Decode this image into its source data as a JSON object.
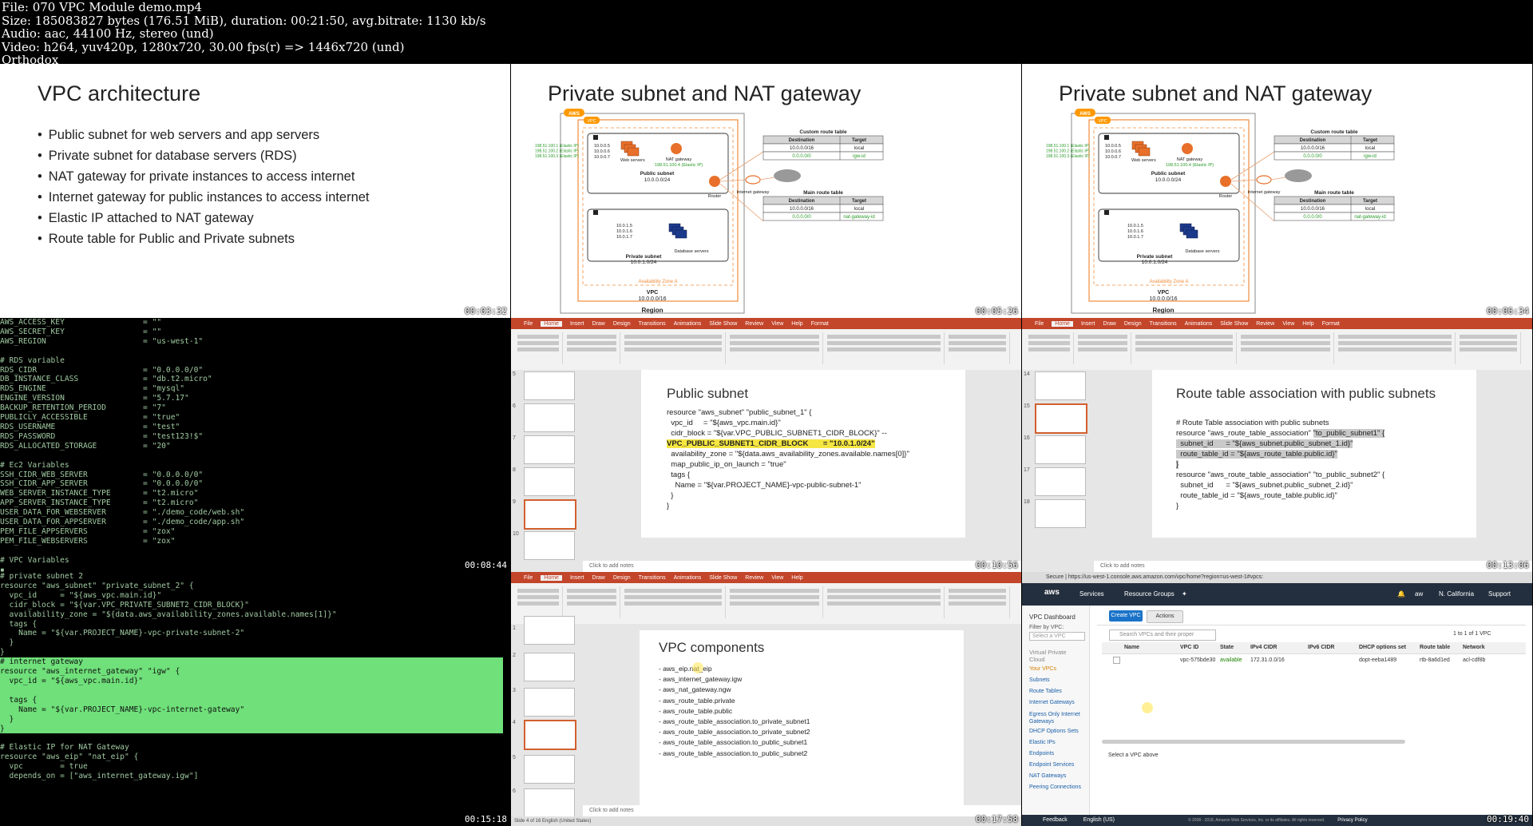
{
  "header": {
    "line1": "File: 070 VPC Module demo.mp4",
    "line2": "Size: 185083827 bytes (176.51 MiB), duration: 00:21:50, avg.bitrate: 1130 kb/s",
    "line3": "Audio: aac, 44100 Hz, stereo (und)",
    "line4": "Video: h264, yuv420p, 1280x720, 30.00 fps(r) => 1446x720 (und)",
    "line5": "Orthodox"
  },
  "tiles": {
    "t1": {
      "timestamp": "00:03:32",
      "title": "VPC architecture",
      "bullets": [
        "Public subnet for web servers and app servers",
        "Private subnet for database servers (RDS)",
        "NAT gateway for private instances to access internet",
        "Internet gateway for public instances to access internet",
        "Elastic IP attached to NAT gateway",
        "Route table for Public and Private subnets"
      ]
    },
    "t2": {
      "timestamp": "00:05:26",
      "title": "Private subnet and NAT gateway"
    },
    "t3": {
      "timestamp": "00:06:34",
      "title": "Private subnet and NAT gateway"
    },
    "diagram": {
      "custom_route_table": "Custom route table",
      "main_route_table": "Main route table",
      "destination": "Destination",
      "target": "Target",
      "cr_rows": [
        [
          "10.0.0.0/16",
          "local"
        ],
        [
          "0.0.0.0/0",
          "igw-id"
        ]
      ],
      "mr_rows": [
        [
          "10.0.0.0/16",
          "local"
        ],
        [
          "0.0.0.0/0",
          "nat-gateway-id"
        ]
      ],
      "public_subnet": "Public subnet",
      "public_cidr": "10.0.0.0/24",
      "private_subnet": "Private subnet",
      "private_cidr": "10.0.1.0/24",
      "vpc": "VPC",
      "vpc_cidr": "10.0.0.0/16",
      "region": "Region",
      "az": "Availability Zone A",
      "web_servers": "Web servers",
      "nat_gateway": "NAT gateway",
      "nat_ip": "198.51.100.4 (Elastic IP)",
      "internet_gateway": "Internet gateway",
      "router": "Router",
      "db_servers": "Database servers",
      "pub_ips": "10.0.0.5\n10.0.0.6\n10.0.0.7",
      "priv_ips": "10.0.1.5\n10.0.1.6\n10.0.1.7",
      "eips": "198.51.100.1 (Elastic IP)\n198.51.100.2 (Elastic IP)\n198.51.100.3 (Elastic IP)",
      "aws": "AWS",
      "vpc_badge": "VPC"
    },
    "t4": {
      "timestamp": "00:08:44",
      "code_a": "AWS_ACCESS_KEY                 = \"\"\nAWS_SECRET_KEY                 = \"\"\nAWS_REGION                     = \"us-west-1\"\n\n# RDS variable\nRDS_CIDR                       = \"0.0.0.0/0\"\nDB_INSTANCE_CLASS              = \"db.t2.micro\"\nRDS_ENGINE                     = \"mysql\"\nENGINE_VERSION                 = \"5.7.17\"\nBACKUP_RETENTION_PERIOD        = \"7\"\nPUBLICLY_ACCESSIBLE            = \"true\"\nRDS_USERNAME                   = \"test\"\nRDS_PASSWORD                   = \"test123!$\"\nRDS_ALLOCATED_STORAGE          = \"20\"\n\n# Ec2 Variables\nSSH_CIDR_WEB_SERVER            = \"0.0.0.0/0\"\nSSH_CIDR_APP_SERVER            = \"0.0.0.0/0\"\nWEB_SERVER_INSTANCE_TYPE       = \"t2.micro\"\nAPP_SERVER_INSTANCE_TYPE       = \"t2.micro\"\nUSER_DATA_FOR_WEBSERVER        = \"./demo_code/web.sh\"\nUSER_DATA_FOR_APPSERVER        = \"./demo_code/app.sh\"\nPEM_FILE_APPSERVERS            = \"zox\"\nPEM_FILE_WEBSERVERS            = \"zox\"\n\n# VPC Variables\n▪"
    },
    "t5": {
      "timestamp": "00:10:56",
      "slide_title": "Public subnet",
      "line1": "resource \"aws_subnet\" \"public_subnet_1\" {",
      "line2": "  vpc_id     = \"${aws_vpc.main.id}\"",
      "line3": "  cidr_block = \"${var.VPC_PUBLIC_SUBNET1_CIDR_BLOCK}\" --",
      "line4a": "VPC_PUBLIC_SUBNET1_CIDR_BLOCK       = ",
      "line4b": "\"10.0.1.0/24\"",
      "line5": "  availability_zone = \"${data.aws_availability_zones.available.names[0]}\"",
      "line6": "  map_public_ip_on_launch = \"true\"",
      "line7": "  tags {",
      "line8": "    Name = \"${var.PROJECT_NAME}-vpc-public-subnet-1\"",
      "line9": "  }",
      "line10": "}",
      "notes": "Click to add notes"
    },
    "t6": {
      "timestamp": "00:13:06",
      "slide_title": "Route table association with public subnets",
      "l1": "# Route Table association with public subnets",
      "l2a": "resource \"aws_route_table_association\" ",
      "l2b": "\"to_public_subnet1\" {",
      "l3": "  subnet_id      = \"${aws_subnet.public_subnet_1.id}\"",
      "l4": "  route_table_id = \"${aws_route_table.public.id}\"",
      "l5": "}",
      "l6": "resource \"aws_route_table_association\" \"to_public_subnet2\" {",
      "l7": "  subnet_id      = \"${aws_subnet.public_subnet_2.id}\"",
      "l8": "  route_table_id = \"${aws_route_table.public.id}\"",
      "l9": "}",
      "notes": "Click to add notes"
    },
    "t7": {
      "timestamp": "00:15:18",
      "code_a": "# private subnet 2\nresource \"aws_subnet\" \"private_subnet_2\" {\n  vpc_id     = \"${aws_vpc.main.id}\"\n  cidr_block = \"${var.VPC_PRIVATE_SUBNET2_CIDR_BLOCK}\"\n  availability_zone = \"${data.aws_availability_zones.available.names[1]}\"\n  tags {\n    Name = \"${var.PROJECT_NAME}-vpc-private-subnet-2\"\n  }\n}\n",
      "code_hl": "# internet gateway\nresource \"aws_internet_gateway\" \"igw\" {\n  vpc_id = \"${aws_vpc.main.id}\"\n\n  tags {\n    Name = \"${var.PROJECT_NAME}-vpc-internet-gateway\"\n  }\n}",
      "code_b": "\n# Elastic IP for NAT Gateway\nresource \"aws_eip\" \"nat_eip\" {\n  vpc        = true\n  depends_on = [\"aws_internet_gateway.igw\"]"
    },
    "t8": {
      "timestamp": "00:17:58",
      "slide_title": "VPC components",
      "items": [
        "- aws_eip.nat_eip",
        "- aws_internet_gateway.igw",
        "- aws_nat_gateway.ngw",
        "- aws_route_table.private",
        "- aws_route_table.public",
        "- aws_route_table_association.to_private_subnet1",
        "- aws_route_table_association.to_private_subnet2",
        "- aws_route_table_association.to_public_subnet1",
        "- aws_route_table_association.to_public_subnet2"
      ],
      "notes": "Click to add notes",
      "status": "Slide 4 of 16    English (United States)"
    },
    "t9": {
      "timestamp": "00:19:40",
      "url": "Secure | https://us-west-1.console.aws.amazon.com/vpc/home?region=us-west-1#vpcs:",
      "services": "Services",
      "resource_groups": "Resource Groups",
      "user": "aw",
      "region": "N. California",
      "support": "Support",
      "dashboard": "VPC Dashboard",
      "filter_by": "Filter by VPC:",
      "select_vpc": "Select a VPC",
      "nav": [
        "Virtual Private Cloud",
        "Your VPCs",
        "Subnets",
        "Route Tables",
        "Internet Gateways",
        "Egress Only Internet Gateways",
        "DHCP Options Sets",
        "Elastic IPs",
        "Endpoints",
        "Endpoint Services",
        "NAT Gateways",
        "Peering Connections"
      ],
      "create_vpc": "Create VPC",
      "actions": "Actions",
      "search_placeholder": "Search VPCs and their proper",
      "count": "1 to 1 of 1 VPC",
      "cols": [
        "Name",
        "VPC ID",
        "State",
        "IPv4 CIDR",
        "IPv6 CIDR",
        "DHCP options set",
        "Route table",
        "Network"
      ],
      "row": [
        "",
        "vpc-575bde30",
        "available",
        "172.31.0.0/16",
        "",
        "dopt-eeba1489",
        "rtb-8a6d1ed",
        "acl-cdf8b"
      ],
      "select_above": "Select a VPC above",
      "feedback": "Feedback",
      "lang": "English (US)",
      "copyright": "© 2008 - 2018, Amazon Web Services, Inc. or its affiliates. All rights reserved.",
      "privacy": "Privacy Policy"
    }
  },
  "colors": {
    "aws_orange": "#ff9900",
    "ppt_red": "#c3452a",
    "term_green": "#6fe07a",
    "aws_navy": "#232f3e",
    "aws_blue": "#1a73c8"
  }
}
